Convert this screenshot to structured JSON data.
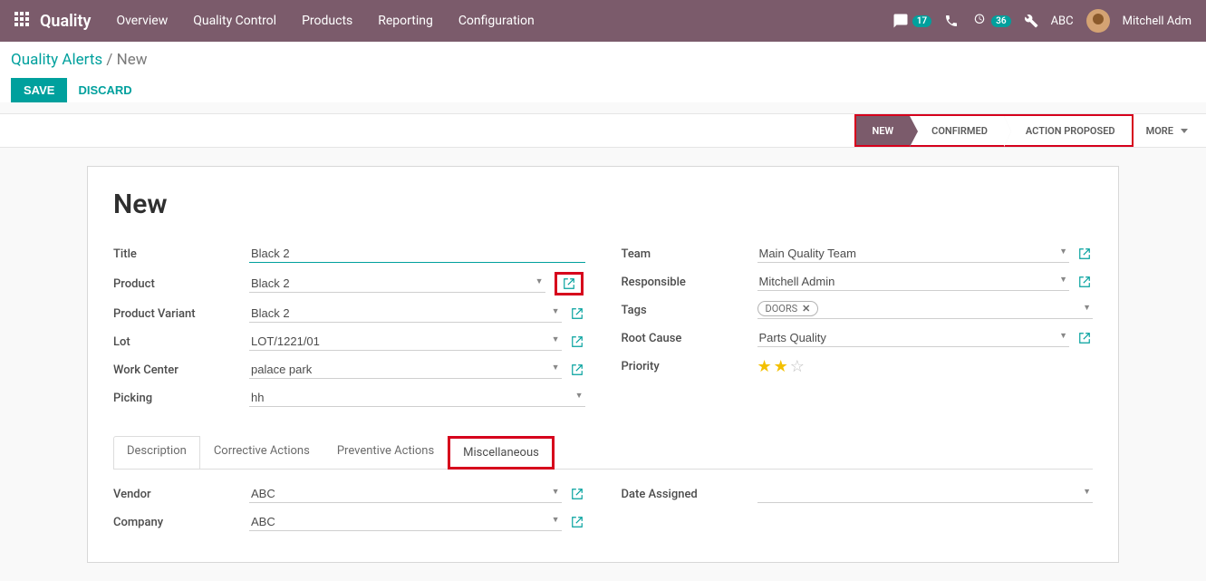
{
  "nav": {
    "brand": "Quality",
    "menu": [
      "Overview",
      "Quality Control",
      "Products",
      "Reporting",
      "Configuration"
    ],
    "msg_count": "17",
    "activity_count": "36",
    "user_short": "ABC",
    "user_name": "Mitchell Adm"
  },
  "breadcrumb": {
    "parent": "Quality Alerts",
    "sep": " / ",
    "current": "New"
  },
  "actions": {
    "save": "SAVE",
    "discard": "DISCARD"
  },
  "status": {
    "stages": [
      "NEW",
      "CONFIRMED",
      "ACTION PROPOSED"
    ],
    "active_index": 0,
    "more": "MORE"
  },
  "form": {
    "heading": "New",
    "left": {
      "title": {
        "label": "Title",
        "value": "Black 2"
      },
      "product": {
        "label": "Product",
        "value": "Black 2"
      },
      "product_variant": {
        "label": "Product Variant",
        "value": "Black 2"
      },
      "lot": {
        "label": "Lot",
        "value": "LOT/1221/01"
      },
      "work_center": {
        "label": "Work Center",
        "value": "palace park"
      },
      "picking": {
        "label": "Picking",
        "value": "hh"
      }
    },
    "right": {
      "team": {
        "label": "Team",
        "value": "Main Quality Team"
      },
      "responsible": {
        "label": "Responsible",
        "value": "Mitchell Admin"
      },
      "tags": {
        "label": "Tags",
        "value": "DOORS"
      },
      "root_cause": {
        "label": "Root Cause",
        "value": "Parts Quality"
      },
      "priority": {
        "label": "Priority",
        "stars": 2
      }
    }
  },
  "tabs": {
    "items": [
      "Description",
      "Corrective Actions",
      "Preventive Actions",
      "Miscellaneous"
    ],
    "active": 3
  },
  "misc": {
    "vendor": {
      "label": "Vendor",
      "value": "ABC"
    },
    "company": {
      "label": "Company",
      "value": "ABC"
    },
    "date_assigned": {
      "label": "Date Assigned",
      "value": ""
    }
  }
}
